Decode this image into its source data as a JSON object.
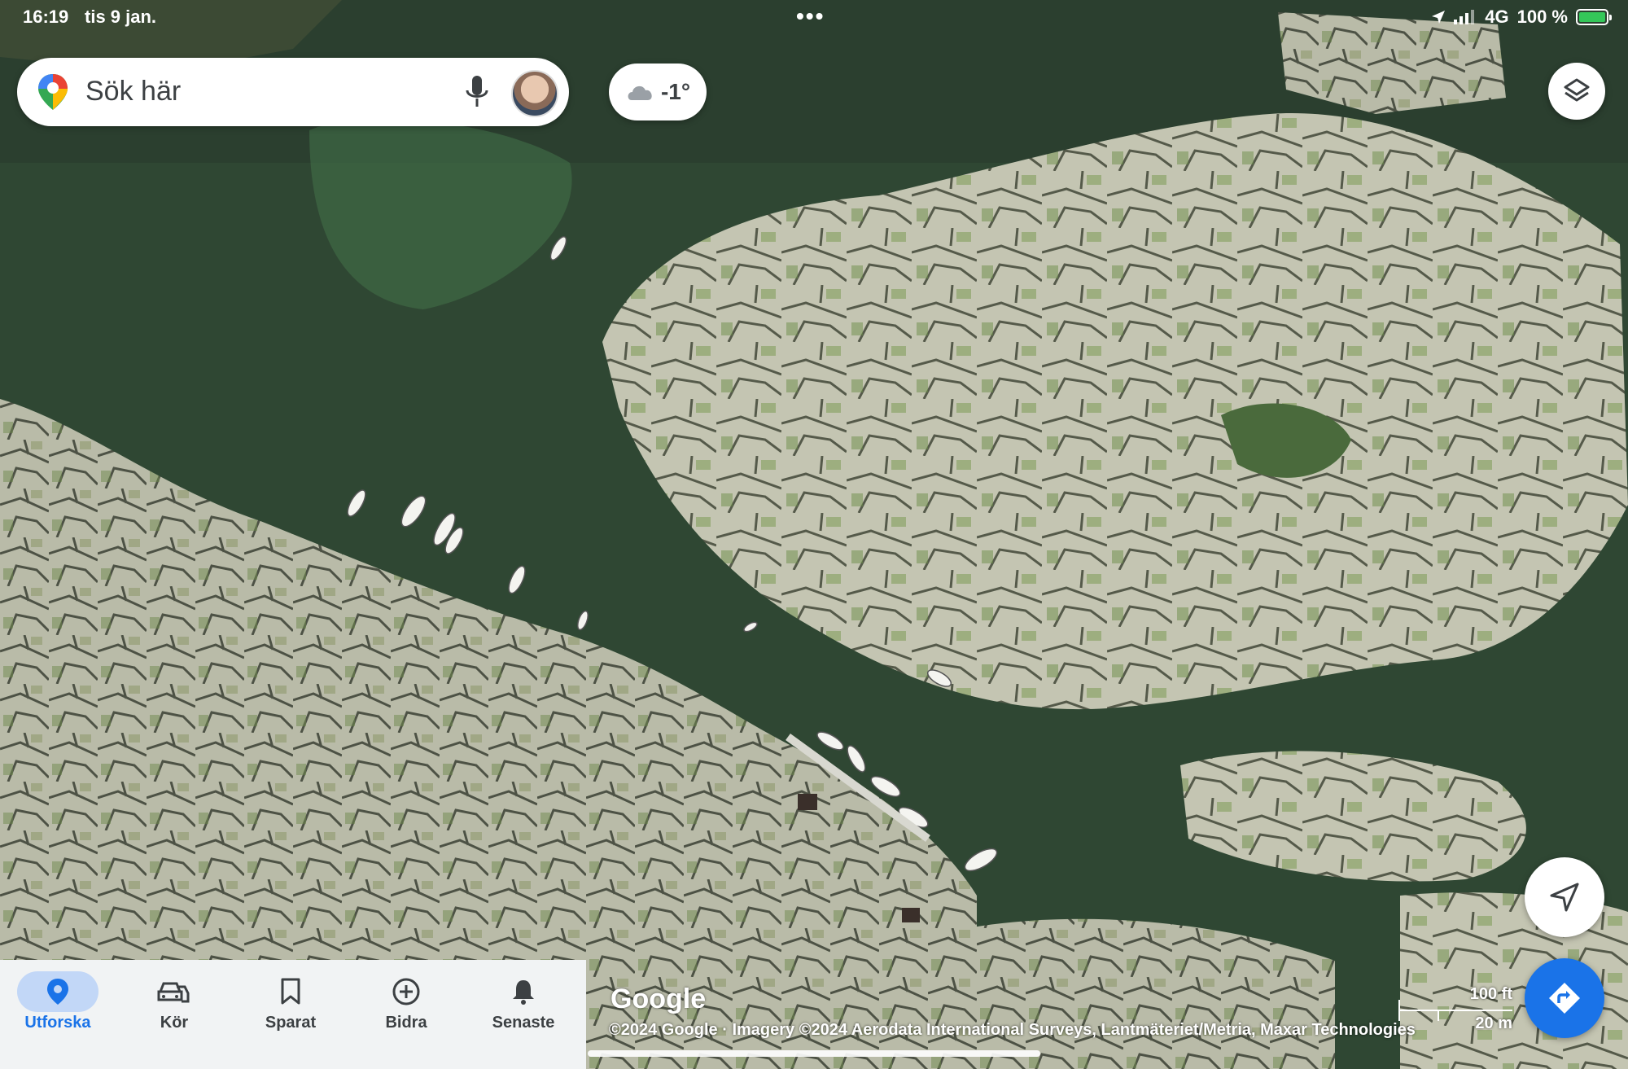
{
  "status_bar": {
    "time": "16:19",
    "date": "tis 9 jan.",
    "dots": "•••",
    "network": "4G",
    "battery": "100 %",
    "battery_level": 1.0
  },
  "search": {
    "placeholder": "Sök här",
    "icons": [
      "maps-pin-icon",
      "microphone-icon",
      "avatar"
    ]
  },
  "weather": {
    "icon": "cloud-icon",
    "temperature": "-1°"
  },
  "controls": {
    "layers_icon": "layers-icon",
    "locate_icon": "navigation-arrow-icon",
    "directions_icon": "directions-icon",
    "accent_color": "#1a73e8"
  },
  "nav": {
    "items": [
      {
        "label": "Utforska",
        "icon": "location-pin-icon",
        "active": true
      },
      {
        "label": "Kör",
        "icon": "car-icon",
        "active": false
      },
      {
        "label": "Sparat",
        "icon": "bookmark-icon",
        "active": false
      },
      {
        "label": "Bidra",
        "icon": "plus-circle-icon",
        "active": false
      },
      {
        "label": "Senaste",
        "icon": "bell-icon",
        "active": false
      }
    ]
  },
  "map": {
    "logo": "Google",
    "attribution": "©2024 Google · Imagery ©2024 Aerodata International Surveys, Lantmäteriet/Metria, Maxar Technologies",
    "scale_ft": "100 ft",
    "scale_m": "20 m"
  }
}
